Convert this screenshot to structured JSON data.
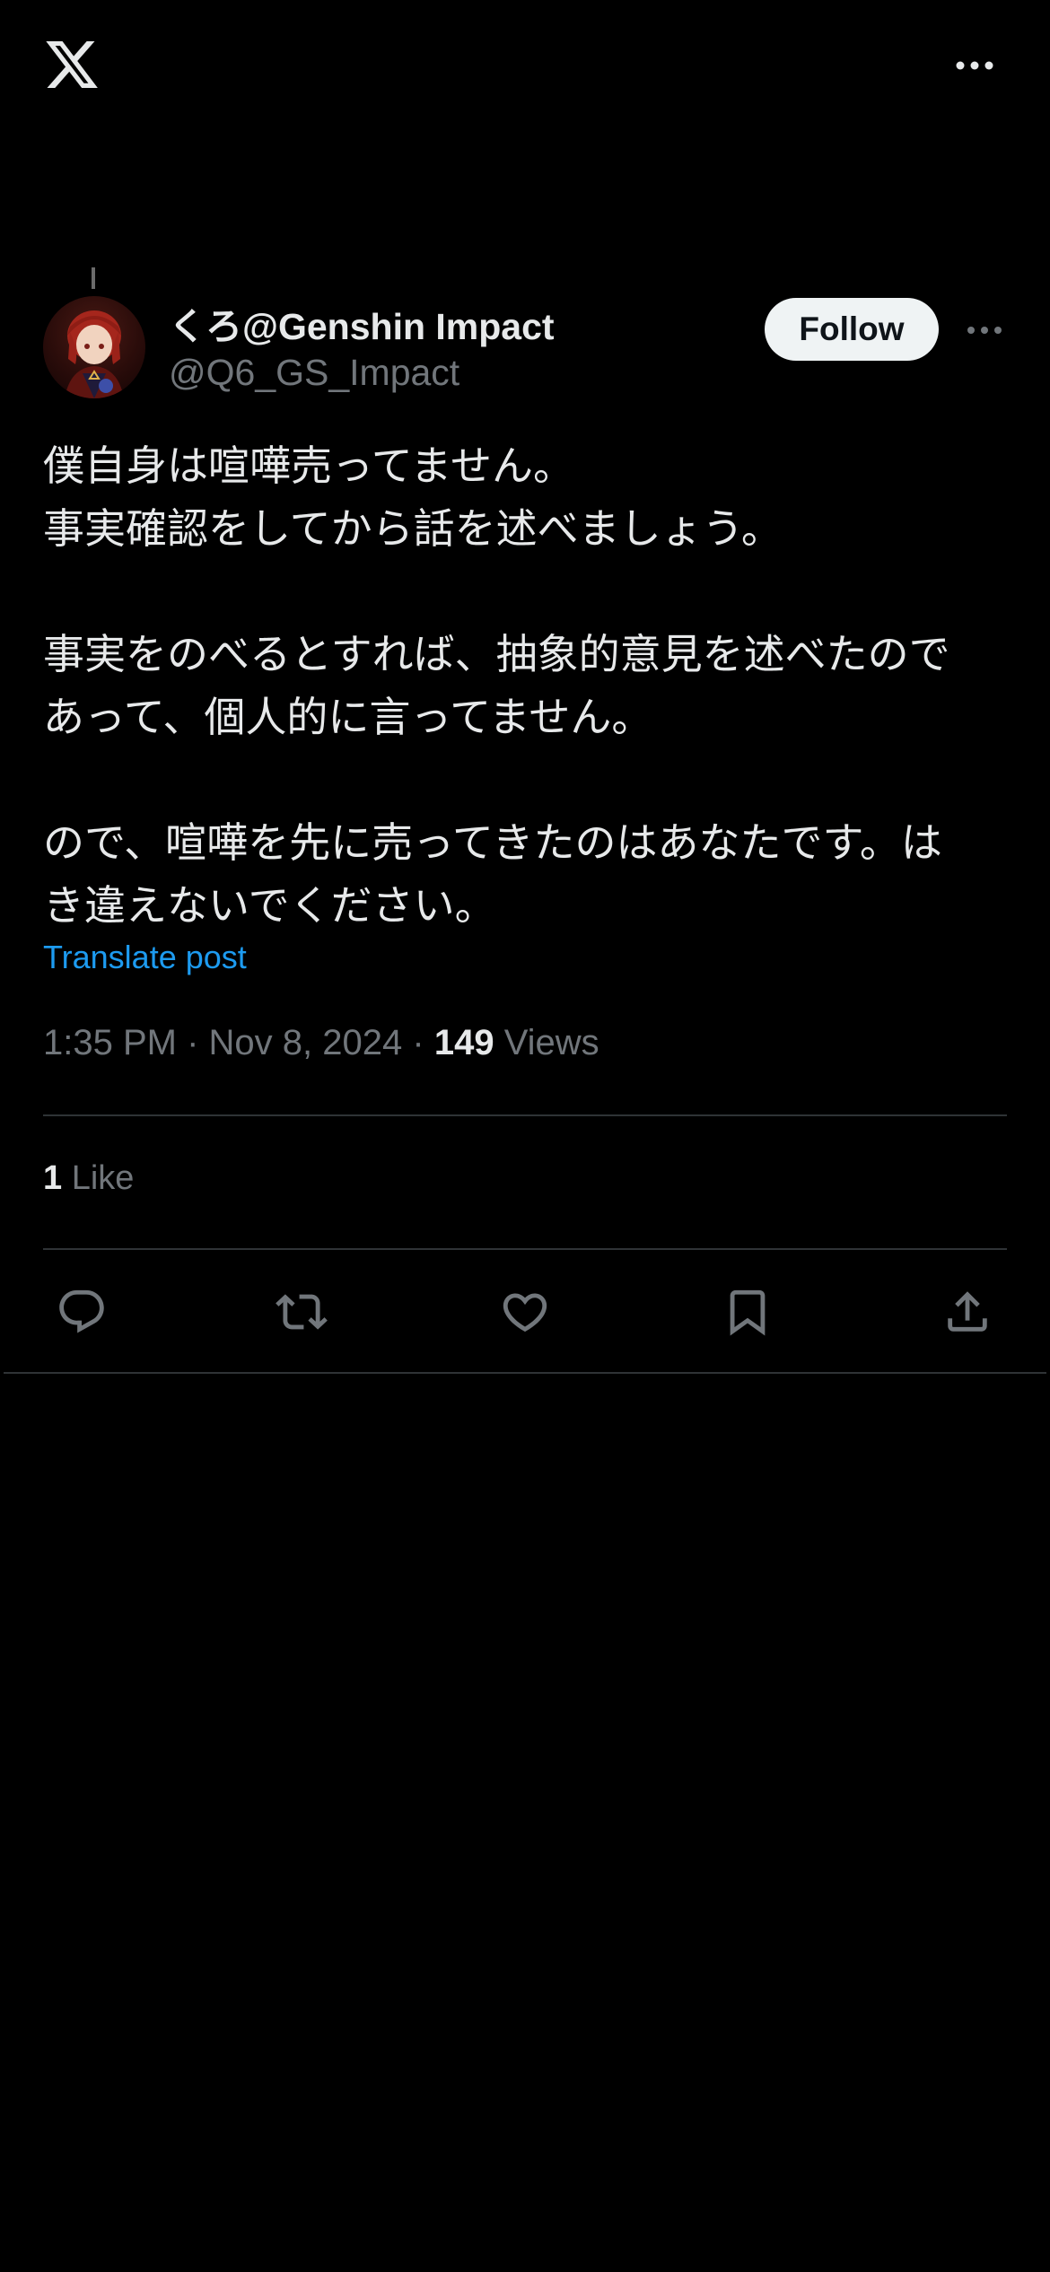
{
  "header": {
    "logo_icon": "x-logo-icon",
    "more_icon": "more-horizontal-icon"
  },
  "author": {
    "display_name": "くろ@Genshin Impact",
    "handle": "@Q6_GS_Impact",
    "follow_label": "Follow"
  },
  "post": {
    "lines": [
      "僕自身は喧嘩売ってません。",
      "事実確認をしてから話を述べましょう。",
      "",
      "事実をのべるとすれば、抽象的意見を述べたので",
      "あって、個人的に言ってません。",
      "",
      "ので、喧嘩を先に売ってきたのはあなたです。は",
      "き違えないでください。"
    ],
    "translate_label": "Translate post",
    "time": "1:35 PM",
    "separator": "·",
    "date": "Nov 8, 2024",
    "views_count": "149",
    "views_label": "Views"
  },
  "engagement": {
    "likes_count": "1",
    "likes_label": "Like"
  },
  "actions": {
    "reply_icon": "reply-icon",
    "repost_icon": "repost-icon",
    "like_icon": "heart-icon",
    "bookmark_icon": "bookmark-icon",
    "share_icon": "share-icon"
  },
  "colors": {
    "background": "#000000",
    "text": "#e7e9ea",
    "secondary": "#71767b",
    "link": "#1d9bf0",
    "divider": "#2f3336",
    "follow_bg": "#eff3f4"
  }
}
